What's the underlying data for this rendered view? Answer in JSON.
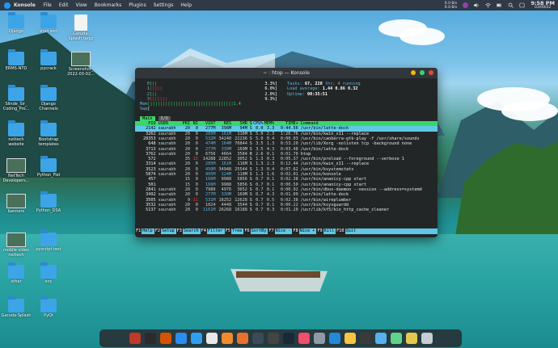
{
  "menubar": {
    "app_name": "Konsole",
    "menus": [
      "File",
      "Edit",
      "View",
      "Bookmarks",
      "Plugins",
      "Settings",
      "Help"
    ],
    "net_up": "0.0 B/s",
    "net_down": "0.0 B/s",
    "time": "9:58 PM",
    "date": "03/09/22"
  },
  "desktop_icons": [
    {
      "label": "Django"
    },
    {
      "label": "shell sort"
    },
    {
      "label": "Garuda-\nSplash.targz"
    },
    {
      "label": "ERMS-NTD"
    },
    {
      "label": "pycrack"
    },
    {
      "label": "Screenshot_\n2022-03-02..."
    },
    {
      "label": "Slinde_Sir_\nCoding_Pro..."
    },
    {
      "label": "Django\nChannels"
    },
    {
      "label": "nettech\nwebsite"
    },
    {
      "label": "Bootstrap\ntemplates"
    },
    {
      "label": "NetTech\nDevelopers..."
    },
    {
      "label": "Python_Fiel"
    },
    {
      "label": "banners"
    },
    {
      "label": "Python_DSA"
    },
    {
      "label": "mobile video\nnettech"
    },
    {
      "label": "pyscript test"
    },
    {
      "label": "other"
    },
    {
      "label": "enc"
    },
    {
      "label": "Garuda-Splash"
    },
    {
      "label": "PyQt"
    }
  ],
  "window": {
    "title": "~ : htop — Konsole"
  },
  "htop": {
    "cpus": [
      {
        "n": "0",
        "bar": "[||",
        "pct": "3.3%]"
      },
      {
        "n": "1",
        "bar": "[||||",
        "pct": "6.0%]"
      },
      {
        "n": "2",
        "bar": "[||",
        "pct": "2.0%]"
      },
      {
        "n": "3",
        "bar": "[||||||",
        "pct": "9.3%]"
      }
    ],
    "mem_label": "Mem",
    "mem_bar": "[|||||||||||||||||||||||||||||||||1.4",
    "swp_label": "Swp",
    "swp_bar": "[",
    "tasks_label": "Tasks:",
    "tasks_value": "67,",
    "thr_value": "228",
    "thr_label": "thr;",
    "running_value": "4",
    "running_label": "running",
    "load_label": "Load average:",
    "load_value": "1.44 0.86 0.32",
    "uptime_label": "Uptime:",
    "uptime_value": "00:35:51",
    "tab_main": "Main",
    "tab_io": "I/O",
    "columns": [
      "PID",
      "USER",
      "PRI",
      "NI",
      "VIRT",
      "RES",
      "SHR",
      "S",
      "CPU%",
      "MEM%",
      "TIME+",
      "Command"
    ],
    "rows": [
      [
        "2142",
        "saurabh",
        "20",
        "0",
        "277M",
        "398M",
        "94M",
        "S",
        "0.0",
        "3.3",
        "0:44.56",
        "/usr/bin/latte-dock"
      ],
      [
        "3262",
        "saurabh",
        "20",
        "0",
        "285M",
        "161M",
        "116M",
        "S",
        "5.0",
        "2.3",
        "1:20.76",
        "/usr/bin/kwin_x11 --replace"
      ],
      [
        "28353",
        "saurabh",
        "20",
        "0",
        "532M",
        "34240",
        "22236",
        "S",
        "5.0",
        "0.4",
        "0:00.03",
        "/usr/bin/canberra-gtk-play -f /usr/share/sounds"
      ],
      [
        "648",
        "saurabh",
        "20",
        "0",
        "474M",
        "164M",
        "70844",
        "S",
        "3.5",
        "1.3",
        "0:53.20",
        "/usr/lib/Xorg -nolisten tcp -background none"
      ],
      [
        "3713",
        "saurabh",
        "20",
        "0",
        "277M",
        "330M",
        "169M",
        "S",
        "3.5",
        "4.3",
        "0:03.48",
        "/usr/bin/latte-dock"
      ],
      [
        "3762",
        "saurabh",
        "20",
        "0",
        "6756",
        "4664",
        "3584",
        "R",
        "2.6",
        "0.1",
        "0:01.70",
        "htop"
      ],
      [
        "572",
        "",
        "35",
        "15",
        "14288",
        "22852",
        "3052",
        "S",
        "1.3",
        "0.3",
        "0:05.37",
        "/usr/bin/preload --foreground --verbose 1"
      ],
      [
        "3314",
        "saurabh",
        "20",
        "0",
        "285M",
        "161M",
        "116M",
        "S",
        "1.3",
        "2.3",
        "0:12.44",
        "/usr/bin/kwin_x11 --replace"
      ],
      [
        "3523",
        "saurabh",
        "20",
        "0",
        "450M",
        "34948",
        "25544",
        "S",
        "1.3",
        "0.4",
        "0:07.62",
        "/usr/bin/ksystemstats"
      ],
      [
        "5874",
        "saurabh",
        "20",
        "0",
        "905M",
        "124M",
        "110M",
        "S",
        "1.3",
        "1.6",
        "0:02.01",
        "/usr/bin/konsole"
      ],
      [
        "457",
        "",
        "15",
        "0",
        "166M",
        "9988",
        "5856",
        "S",
        "0.7",
        "0.1",
        "0:02.38",
        "/usr/bin/ananicy-cpp start"
      ],
      [
        "501",
        "",
        "15",
        "0",
        "166M",
        "9988",
        "5856",
        "S",
        "0.7",
        "0.1",
        "0:00.50",
        "/usr/bin/ananicy-cpp start"
      ],
      [
        "2841",
        "saurabh",
        "20",
        "0",
        "7980",
        "4976",
        "3652",
        "S",
        "0.7",
        "0.1",
        "0:00.92",
        "/usr/bin/dbus-daemon --session --address=systemd"
      ],
      [
        "3492",
        "saurabh",
        "20",
        "0",
        "277M",
        "330M",
        "169M",
        "S",
        "0.7",
        "4.3",
        "0:01.09",
        "/usr/bin/latte-dock"
      ],
      [
        "3505",
        "saurabh",
        "9",
        "-11",
        "531M",
        "16252",
        "12628",
        "S",
        "0.7",
        "0.5",
        "0:02.38",
        "/usr/bin/wireplumber"
      ],
      [
        "3532",
        "saurabh",
        "20",
        "0",
        "1024",
        "4448",
        "3544",
        "S",
        "0.7",
        "0.1",
        "0:00.22",
        "/usr/bin/ksysguardd"
      ],
      [
        "5137",
        "saurabh",
        "20",
        "0",
        "1161M",
        "26268",
        "16188",
        "S",
        "0.7",
        "0.3",
        "0:01.20",
        "/usr/lib/kf5/kio_http_cache_cleaner"
      ]
    ],
    "fkeys": [
      {
        "k": "F1",
        "l": "Help"
      },
      {
        "k": "F2",
        "l": "Setup"
      },
      {
        "k": "F3",
        "l": "Search"
      },
      {
        "k": "F4",
        "l": "Filter"
      },
      {
        "k": "F5",
        "l": "Tree"
      },
      {
        "k": "F6",
        "l": "SortBy"
      },
      {
        "k": "F7",
        "l": "Nice -"
      },
      {
        "k": "F8",
        "l": "Nice +"
      },
      {
        "k": "F9",
        "l": "Kill"
      },
      {
        "k": "F10",
        "l": "Quit"
      }
    ]
  },
  "dock": {
    "apps": [
      {
        "name": "garuda-icon",
        "color": "#c0392b"
      },
      {
        "name": "font-app-icon",
        "color": "#2b2b2b"
      },
      {
        "name": "libreoffice-icon",
        "color": "#d35400"
      },
      {
        "name": "app-store-icon",
        "color": "#2d8cf0"
      },
      {
        "name": "safari-icon",
        "color": "#2f9ff2"
      },
      {
        "name": "chrome-icon",
        "color": "#e8e8e8"
      },
      {
        "name": "brave-icon",
        "color": "#f28b2b"
      },
      {
        "name": "firefox-icon",
        "color": "#e8702a"
      },
      {
        "name": "speedometer-icon",
        "color": "#3b4a57"
      },
      {
        "name": "terminal-icon",
        "color": "#444"
      },
      {
        "name": "steam-icon",
        "color": "#1b2838"
      },
      {
        "name": "music-icon",
        "color": "#f24d6b"
      },
      {
        "name": "settings-icon",
        "color": "#8e9aa6"
      },
      {
        "name": "code-icon",
        "color": "#2389d7"
      },
      {
        "name": "pencil-app-icon",
        "color": "#f7c542"
      },
      {
        "name": "cursor-app-icon",
        "color": "#3a3a3a"
      },
      {
        "name": "files-icon",
        "color": "#58b0f0"
      },
      {
        "name": "stacks-icon",
        "color": "#5fd38a"
      },
      {
        "name": "archive-icon",
        "color": "#e5c94f"
      },
      {
        "name": "trash-icon",
        "color": "#c5ccd3"
      }
    ]
  }
}
